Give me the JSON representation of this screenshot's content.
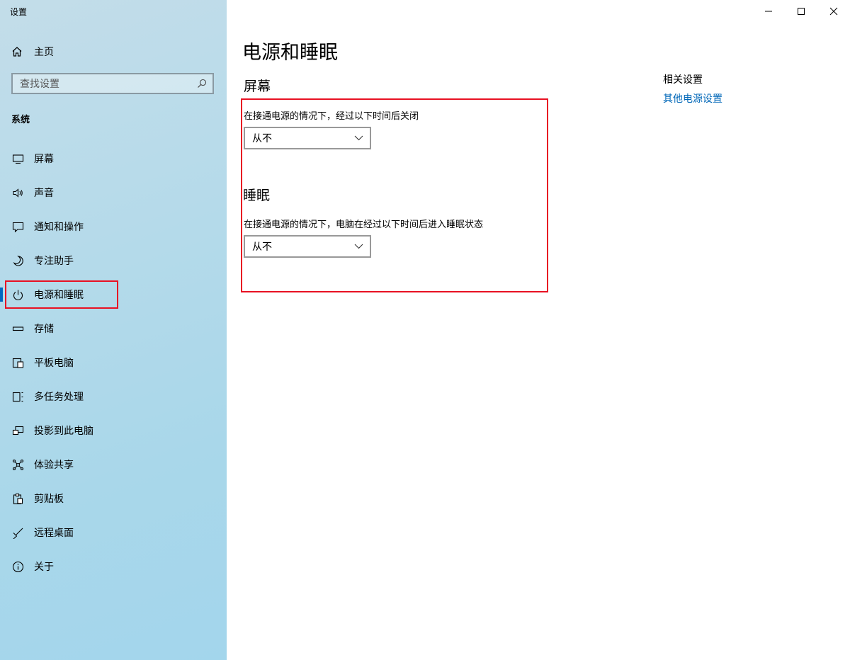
{
  "window": {
    "title": "设置",
    "controls": {
      "minimize": "minimize-icon",
      "maximize": "maximize-icon",
      "close": "close-icon"
    }
  },
  "sidebar": {
    "home_label": "主页",
    "search_placeholder": "查找设置",
    "section_label": "系统",
    "items": [
      {
        "label": "屏幕",
        "icon": "monitor-icon"
      },
      {
        "label": "声音",
        "icon": "speaker-icon"
      },
      {
        "label": "通知和操作",
        "icon": "notification-icon"
      },
      {
        "label": "专注助手",
        "icon": "moon-icon"
      },
      {
        "label": "电源和睡眠",
        "icon": "power-icon",
        "selected": true
      },
      {
        "label": "存储",
        "icon": "storage-icon"
      },
      {
        "label": "平板电脑",
        "icon": "tablet-icon"
      },
      {
        "label": "多任务处理",
        "icon": "multitask-icon"
      },
      {
        "label": "投影到此电脑",
        "icon": "project-icon"
      },
      {
        "label": "体验共享",
        "icon": "share-icon"
      },
      {
        "label": "剪贴板",
        "icon": "clipboard-icon"
      },
      {
        "label": "远程桌面",
        "icon": "remote-desktop-icon"
      },
      {
        "label": "关于",
        "icon": "info-icon"
      }
    ]
  },
  "main": {
    "title": "电源和睡眠",
    "screen": {
      "heading": "屏幕",
      "description": "在接通电源的情况下，经过以下时间后关闭",
      "value": "从不"
    },
    "sleep": {
      "heading": "睡眠",
      "description": "在接通电源的情况下，电脑在经过以下时间后进入睡眠状态",
      "value": "从不"
    },
    "related": {
      "title": "相关设置",
      "link": "其他电源设置"
    }
  },
  "colors": {
    "accent": "#0067c0",
    "link": "#0067b8",
    "highlight_border": "#e81123",
    "sidebar_bg": "#a9d7ea"
  }
}
